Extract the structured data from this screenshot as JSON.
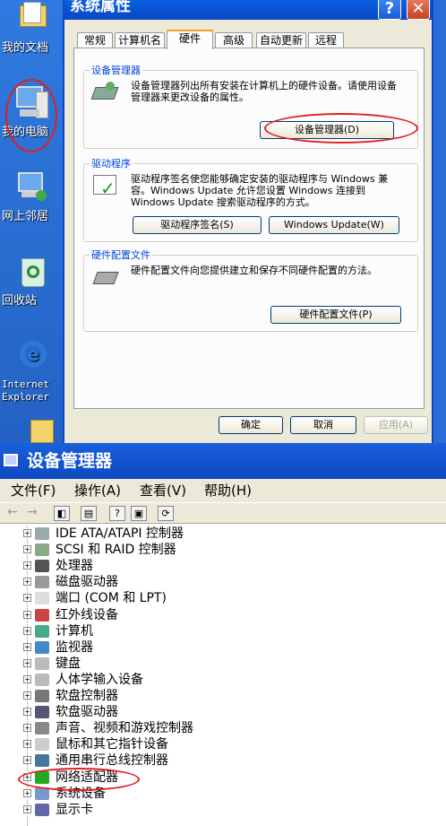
{
  "desktop": {
    "icons": [
      {
        "label": "我的文档",
        "icon": "my-documents-icon"
      },
      {
        "label": "我的电脑",
        "icon": "my-computer-icon"
      },
      {
        "label": "网上邻居",
        "icon": "network-neighborhood-icon"
      },
      {
        "label": "回收站",
        "icon": "recycle-bin-icon"
      },
      {
        "label": "Internet",
        "label2": "Explorer",
        "icon": "internet-explorer-icon"
      }
    ]
  },
  "dialog": {
    "title": "系统属性",
    "help": "?",
    "close": "✕",
    "tabs": [
      "常规",
      "计算机名",
      "硬件",
      "高级",
      "自动更新",
      "远程"
    ],
    "active_tab": "硬件",
    "device_manager": {
      "title": "设备管理器",
      "text": "设备管理器列出所有安装在计算机上的硬件设备。请使用设备管理器来更改设备的属性。",
      "button": "设备管理器(D)"
    },
    "drivers": {
      "title": "驱动程序",
      "text": "驱动程序签名使您能够确定安装的驱动程序与 Windows 兼容。Windows Update 允许您设置 Windows 连接到 Windows Update 搜索驱动程序的方式。",
      "button_signing": "驱动程序签名(S)",
      "button_update": "Windows Update(W)"
    },
    "hw_profiles": {
      "title": "硬件配置文件",
      "text": "硬件配置文件向您提供建立和保存不同硬件配置的方法。",
      "button": "硬件配置文件(P)"
    },
    "ok": "确定",
    "cancel": "取消",
    "apply": "应用(A)"
  },
  "device_manager_window": {
    "title": "设备管理器",
    "menus": [
      "文件(F)",
      "操作(A)",
      "查看(V)",
      "帮助(H)"
    ],
    "tree": [
      {
        "label": "IDE ATA/ATAPI 控制器",
        "icon": "ide-controller-icon"
      },
      {
        "label": "SCSI 和 RAID 控制器",
        "icon": "scsi-controller-icon"
      },
      {
        "label": "处理器",
        "icon": "processor-icon"
      },
      {
        "label": "磁盘驱动器",
        "icon": "disk-drive-icon"
      },
      {
        "label": "端口 (COM 和 LPT)",
        "icon": "port-icon"
      },
      {
        "label": "红外线设备",
        "icon": "infrared-icon"
      },
      {
        "label": "计算机",
        "icon": "computer-icon"
      },
      {
        "label": "监视器",
        "icon": "monitor-icon"
      },
      {
        "label": "键盘",
        "icon": "keyboard-icon"
      },
      {
        "label": "人体学输入设备",
        "icon": "hid-icon"
      },
      {
        "label": "软盘控制器",
        "icon": "floppy-controller-icon"
      },
      {
        "label": "软盘驱动器",
        "icon": "floppy-drive-icon"
      },
      {
        "label": "声音、视频和游戏控制器",
        "icon": "sound-icon"
      },
      {
        "label": "鼠标和其它指针设备",
        "icon": "mouse-icon"
      },
      {
        "label": "通用串行总线控制器",
        "icon": "usb-icon"
      },
      {
        "label": "网络适配器",
        "icon": "network-adapter-icon"
      },
      {
        "label": "系统设备",
        "icon": "system-device-icon"
      },
      {
        "label": "显示卡",
        "icon": "display-adapter-icon"
      }
    ]
  }
}
